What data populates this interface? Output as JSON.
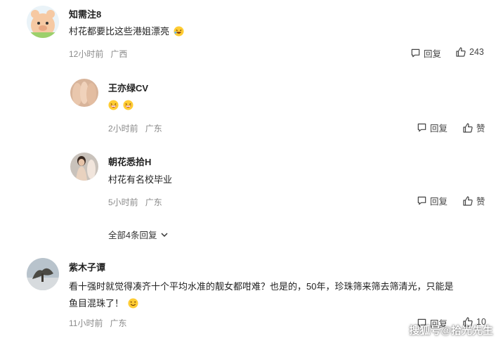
{
  "comments": [
    {
      "user": "知需注8",
      "text": "村花都要比这些港姐漂亮",
      "time": "12小时前",
      "location": "广西",
      "reply_label": "回复",
      "like_label": "243",
      "replies": [
        {
          "user": "王亦绿CV",
          "time": "2小时前",
          "location": "广东",
          "reply_label": "回复",
          "like_label": "赞"
        },
        {
          "user": "朝花悉拾H",
          "text": "村花有名校毕业",
          "time": "5小时前",
          "location": "广东",
          "reply_label": "回复",
          "like_label": "赞"
        }
      ],
      "more_replies": "全部4条回复"
    },
    {
      "user": "紫木子谭",
      "text_line1": "看十强时就觉得凑齐十个平均水准的靓女都咁难？也是的，50年，珍珠筛来筛去筛清光，只能是",
      "text_line2": "鱼目混珠了！",
      "time": "11小时前",
      "location": "广东",
      "reply_label": "回复",
      "like_label": "10"
    }
  ],
  "watermark": "搜狐号@拾光先生",
  "icons": [
    "reply-icon",
    "like-icon",
    "chevron-down-icon",
    "laughing-emoji-icon",
    "grin-emoji-icon"
  ],
  "colors": {
    "meta": "#8a8a8a",
    "text": "#222222",
    "background": "#ffffff"
  }
}
